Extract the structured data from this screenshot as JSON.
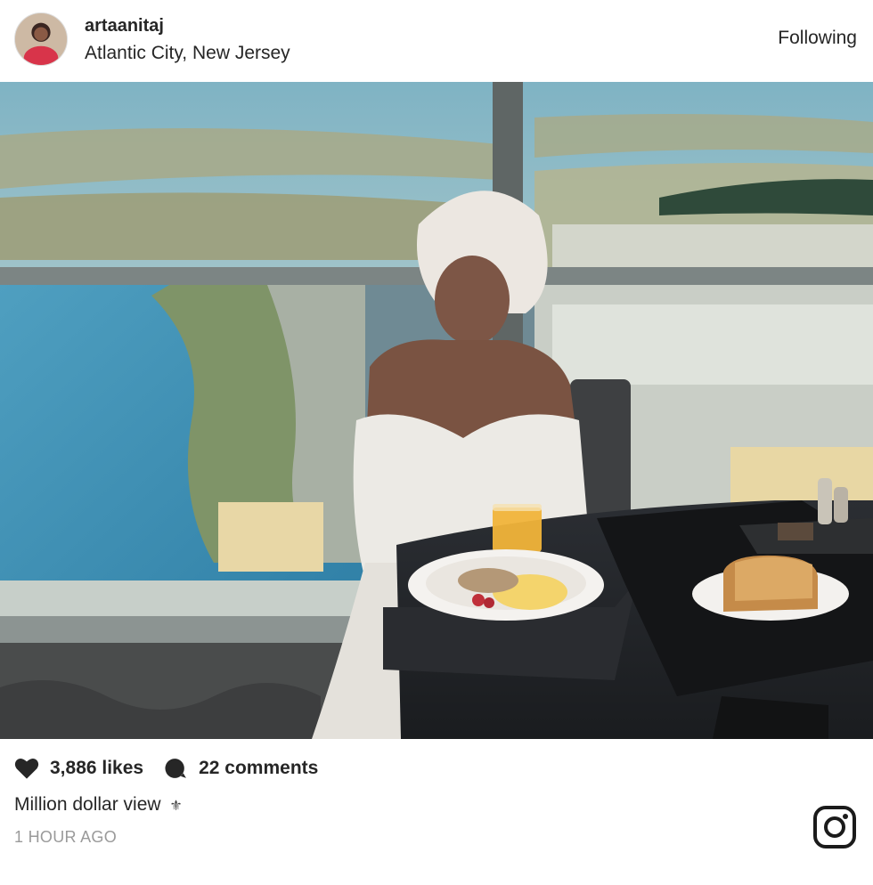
{
  "post": {
    "username": "artaanitaj",
    "location": "Atlantic City, New Jersey",
    "follow_label": "Following",
    "likes": "3,886 likes",
    "comments": "22 comments",
    "caption": "Million dollar view",
    "caption_emoji": "⚜",
    "timestamp": "1 HOUR AGO"
  },
  "icons": {
    "like": "heart-icon",
    "comment": "comment-bubble-icon",
    "brand": "instagram-logo-icon"
  },
  "colors": {
    "text": "#262626",
    "muted": "#9a9a9a",
    "background": "#ffffff"
  }
}
